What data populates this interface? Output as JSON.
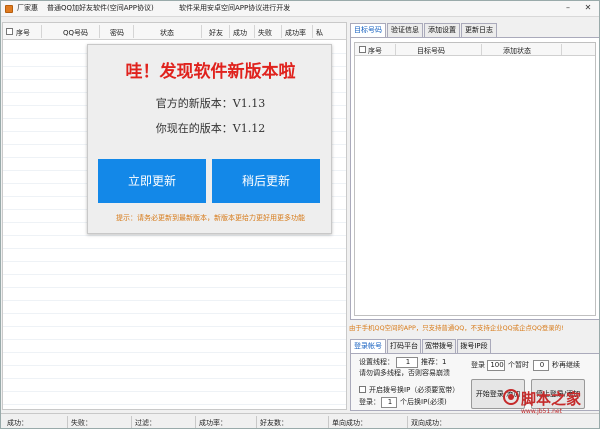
{
  "title": {
    "app": "厂家惠",
    "subtitle": "普通QQ加好友软件(空间APP协议)",
    "notice": "软件采用安卓空间APP协议进行开发"
  },
  "grid": {
    "columns": [
      "序号",
      "QQ号码",
      "密码",
      "状态",
      "好友",
      "成功",
      "失败",
      "成功率",
      "私"
    ]
  },
  "popup": {
    "headline": "哇！发现软件新版本啦",
    "official_version": "官方的新版本：V1.13",
    "current_version": "你现在的版本：V1.12",
    "update_now": "立即更新",
    "update_later": "稍后更新",
    "tip": "提示：请务必更新到最新版本，新版本更给力更好用更多功能"
  },
  "right_tabs": [
    "目标号码",
    "验证信息",
    "添加设置",
    "更新日志"
  ],
  "target_list": {
    "columns": [
      "序号",
      "目标号码",
      "添加状态"
    ]
  },
  "warning": "由于手机QQ空间的APP，只支持普通QQ，不支持企业QQ或企点QQ登录的!",
  "bottom_tabs": [
    "登录帐号",
    "打码平台",
    "宽带拨号",
    "拨号IP段"
  ],
  "settings": {
    "threads_label": "设置线程：",
    "threads_value": "1",
    "recommend": "推荐：1",
    "warn_threads": "请勿调多线程，否则容易崩溃",
    "login_label": "登录",
    "login_value": "100",
    "pause_label": "个暂时",
    "pause_value": "0",
    "continue_label": "秒再继续",
    "dial_label": "开启拨号换IP（必须要宽带）",
    "login2_label": "登录：",
    "login2_value": "1",
    "after_label": "个后换IP(必须)",
    "start_button": "开始登录/添加",
    "stop_button": "停止登录/添加"
  },
  "status_bar": [
    "成功：",
    "失败：",
    "过滤：",
    "成功率：",
    "好友数：",
    "单向成功：",
    "双向成功："
  ],
  "watermark": {
    "text": "脚本之家",
    "url": "www.jb51.net"
  }
}
